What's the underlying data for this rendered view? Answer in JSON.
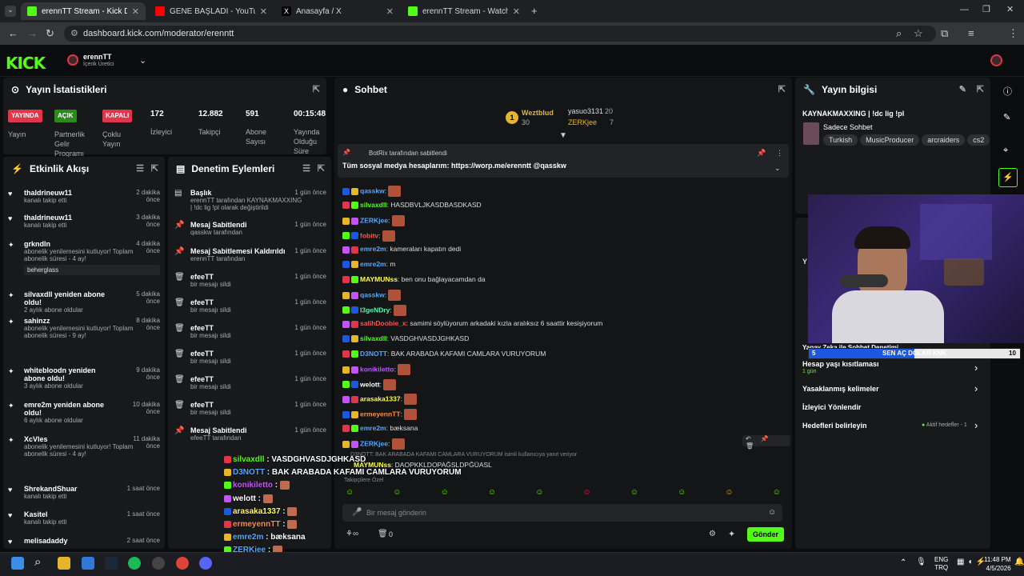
{
  "browser": {
    "tabs": [
      "erennTT Stream - Kick Dashboard",
      "GENE BAŞLADI - YouTube",
      "Anasayfa / X",
      "erennTT Stream - Watch Live on"
    ],
    "url": "dashboard.kick.com/moderator/erenntt"
  },
  "header": {
    "logo": "KICK",
    "channel": "erennTT",
    "role": "İçerik Üretici"
  },
  "stats": {
    "title": "Yayın İstatistikleri",
    "items": [
      {
        "badge": "YAYINDA",
        "label": "Yayın"
      },
      {
        "badge": "AÇIK",
        "label": "Partnerlik Gelir Programı"
      },
      {
        "badge": "KAPALI",
        "label": "Çoklu Yayın"
      },
      {
        "value": "172",
        "label": "İzleyici"
      },
      {
        "value": "12.882",
        "label": "Takipçi"
      },
      {
        "value": "591",
        "label": "Abone Sayısı"
      },
      {
        "value": "00:15:48",
        "label": "Yayında Olduğu Süre"
      }
    ]
  },
  "activity": {
    "title": "Etkinlik Akışı",
    "items": [
      {
        "name": "thaldrineuw11",
        "sub": "kanalı takip etti",
        "time": "2 dakika önce"
      },
      {
        "name": "thaldrineuw11",
        "sub": "kanalı takip etti",
        "time": "3 dakika önce"
      },
      {
        "name": "grkndln",
        "sub": "abonelik yenilemesini kutluyor! Toplam abonelik süresi - 4 ay!",
        "time": "4 dakika önce",
        "note": "beherglass"
      },
      {
        "name": "silvaxdll yeniden abone oldu!",
        "sub": "2 aylık abone oldular",
        "time": "5 dakika önce"
      },
      {
        "name": "sahinzz",
        "sub": "abonelik yenilemesini kutluyor! Toplam abonelik süresi - 9 ay!",
        "time": "8 dakika önce"
      },
      {
        "name": "whitebloodn yeniden abone oldu!",
        "sub": "3 aylık abone oldular",
        "time": "9 dakika önce"
      },
      {
        "name": "emre2m yeniden abone oldu!",
        "sub": "6 aylık abone oldular",
        "time": "10 dakika önce"
      },
      {
        "name": "XcVles",
        "sub": "abonelik yenilemesini kutluyor! Toplam abonelik süresi - 4 ay!",
        "time": "11 dakika önce"
      },
      {
        "name": "ShrekandShuar",
        "sub": "kanalı takip etti",
        "time": "1 saat önce"
      },
      {
        "name": "Kasitel",
        "sub": "kanalı takip etti",
        "time": "1 saat önce"
      },
      {
        "name": "melisadaddy",
        "sub": "",
        "time": "2 saat önce"
      }
    ]
  },
  "modlog": {
    "title": "Denetim Eylemleri",
    "items": [
      {
        "title": "Başlık",
        "sub": "erennTT tarafından KAYNAKMAXXING | !dc lig !pl olarak değiştirildi",
        "time": "1 gün önce"
      },
      {
        "title": "Mesaj Sabitlendi",
        "sub": "qasskw tarafından",
        "time": "1 gün önce"
      },
      {
        "title": "Mesaj Sabitlemesi Kaldırıldı",
        "sub": "erennTT tarafından",
        "time": "1 gün önce"
      },
      {
        "title": "efeeTT",
        "sub": "bir mesajı sildi",
        "time": "1 gün önce"
      },
      {
        "title": "efeeTT",
        "sub": "bir mesajı sildi",
        "time": "1 gün önce"
      },
      {
        "title": "efeeTT",
        "sub": "bir mesajı sildi",
        "time": "1 gün önce"
      },
      {
        "title": "efeeTT",
        "sub": "bir mesajı sildi",
        "time": "1 gün önce"
      },
      {
        "title": "efeeTT",
        "sub": "bir mesajı sildi",
        "time": "1 gün önce"
      },
      {
        "title": "efeeTT",
        "sub": "bir mesajı sildi",
        "time": "1 gün önce"
      },
      {
        "title": "Mesaj Sabitlendi",
        "sub": "efeeTT tarafından",
        "time": "1 gün önce"
      }
    ]
  },
  "chat": {
    "title": "Sohbet",
    "leaders": [
      {
        "name": "Weztblud",
        "n": "30"
      },
      {
        "name": "yasuo3131",
        "n": "20"
      },
      {
        "name": "ZERKjee",
        "n": "7"
      }
    ],
    "pinned_by": "BotRix tarafından sabitlendi",
    "pinned_text": "Tüm sosyal medya hesaplarım: https://worp.me/erenntt @qasskw",
    "messages": [
      {
        "u": "qasskw",
        "t": "",
        "c": "#53a8fc"
      },
      {
        "u": "silvaxdll",
        "t": "HASDBVLJKASDBASDKASD",
        "c": "#53fc18"
      },
      {
        "u": "ZERKjee",
        "t": "",
        "c": "#53a8fc"
      },
      {
        "u": "fobitv",
        "t": "",
        "c": "#fc5353"
      },
      {
        "u": "emre2m",
        "t": "kameraları kapatın dedi",
        "c": "#53a8fc"
      },
      {
        "u": "emre2m",
        "t": "m",
        "c": "#53a8fc"
      },
      {
        "u": "MAYMUNss",
        "t": "ben onu bağlayacamdan da",
        "c": "#fcfc53"
      },
      {
        "u": "qasskw",
        "t": "",
        "c": "#53a8fc"
      },
      {
        "u": "l3geNDry",
        "t": "",
        "c": "#53fca8"
      },
      {
        "u": "salihDoobie_x",
        "t": "samimi söylüyorum arkadaki kızla aralıksız 6 saattir kesişiyorum",
        "c": "#fc5353"
      },
      {
        "u": "silvaxdll",
        "t": "VASDGHVASDJGHKASD",
        "c": "#53fc18"
      },
      {
        "u": "D3NOTT",
        "t": "BAK ARABADA KAFAMI CAMLARA VURUYORUM",
        "c": "#53a8fc"
      },
      {
        "u": "konikiletto",
        "t": "",
        "c": "#c553fc"
      },
      {
        "u": "welott",
        "t": "",
        "c": "#ffffff"
      },
      {
        "u": "arasaka1337",
        "t": "",
        "c": "#fcfc53"
      },
      {
        "u": "ermeyennTT",
        "t": "",
        "c": "#fc8a53"
      },
      {
        "u": "emre2m",
        "t": "bæksana",
        "c": "#53a8fc"
      },
      {
        "u": "ZERKjee",
        "t": "",
        "c": "#53a8fc"
      }
    ],
    "reply_note": "D3NOTT: BAK ARABADA KAFAMI CAMLARA VURUYORUM isimli kullanıcıya yanıt veriyor",
    "last": {
      "u": "MAYMUNss",
      "t": "DAOPKKLDOPAĞSLDPĞÜASL"
    },
    "followers_only": "Takipçilere Özel",
    "placeholder": "Bir mesaj gönderin",
    "send": "Gönder",
    "count": "0"
  },
  "overlay": [
    {
      "u": "silvaxdll",
      "t": "VASDGHVASDJGHKASD"
    },
    {
      "u": "D3NOTT",
      "t": "BAK ARABADA KAFAMI CAMLARA VURUYORUM"
    },
    {
      "u": "konikiletto",
      "t": ""
    },
    {
      "u": "welott",
      "t": ""
    },
    {
      "u": "arasaka1337",
      "t": ""
    },
    {
      "u": "ermeyennTT",
      "t": ""
    },
    {
      "u": "emre2m",
      "t": "bæksana"
    },
    {
      "u": "ZERKjee",
      "t": ""
    },
    {
      "u": "MAYMUNss",
      "t": "DAOPKKLDOPAĞSLDPĞÜASL"
    }
  ],
  "streaminfo": {
    "title": "Yayın bilgisi",
    "stream_title": "KAYNAKMAXXING | !dc lig !pl",
    "category": "Sadece Sohbet",
    "tags": [
      "Turkish",
      "MusicProducer",
      "arcraiders",
      "cs2"
    ]
  },
  "settings": {
    "ai_mod": "Yapay Zeka ile Sohbet Denetimi",
    "account_age": "Hesap yaşı kısıtlaması",
    "account_age_val": "1 gün",
    "banned_words": "Yasaklanmış kelimeler",
    "viewer_redirect": "İzleyici Yönlendir",
    "goals": "Hedefleri belirleyin",
    "goals_val": "Aktif hedefler - 1"
  },
  "goalbar": {
    "left": "5",
    "text": "SEN AÇ DOLAR KNK",
    "right": "10",
    "progress": 0.5
  },
  "taskbar": {
    "lang1": "ENG",
    "lang2": "TRQ",
    "time": "11:48 PM",
    "date": "4/5/2026"
  }
}
